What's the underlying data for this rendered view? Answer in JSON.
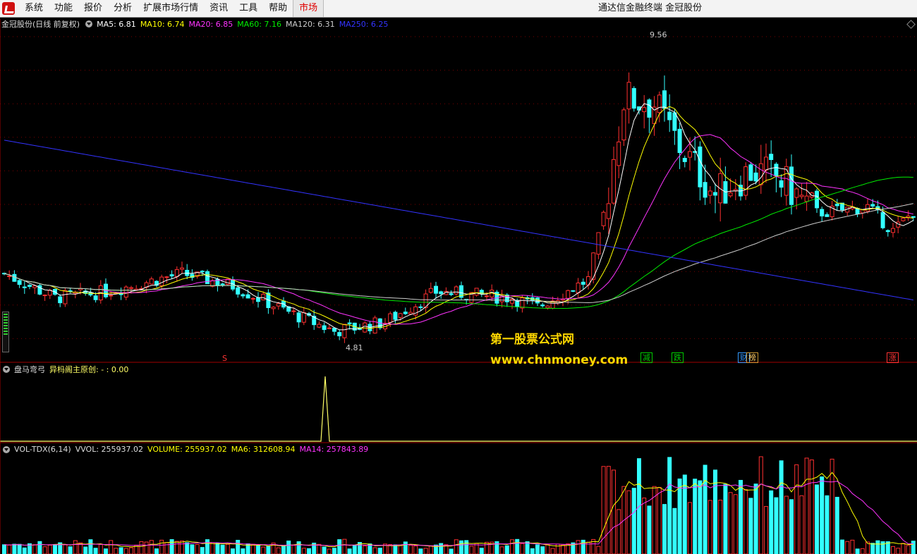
{
  "menu": {
    "items": [
      "系统",
      "功能",
      "报价",
      "分析",
      "扩展市场行情",
      "资讯",
      "工具",
      "帮助"
    ],
    "active_item": "市场",
    "window_title": "通达信金融终端  金冠股份"
  },
  "price_panel": {
    "stock_label": "金冠股份(日线 前复权)",
    "ma": [
      {
        "label": "MA5: 6.81",
        "color": "#ffffff"
      },
      {
        "label": "MA10: 6.74",
        "color": "#ffff00"
      },
      {
        "label": "MA20: 6.85",
        "color": "#ff33ff"
      },
      {
        "label": "MA60: 7.16",
        "color": "#00ee00"
      },
      {
        "label": "MA120: 6.31",
        "color": "#cccccc"
      },
      {
        "label": "MA250: 6.25",
        "color": "#3333ff"
      }
    ],
    "high_label": "9.56",
    "low_label": "4.81",
    "price_range": [
      4.6,
      9.9
    ]
  },
  "markers": {
    "s": "S",
    "tags": [
      {
        "text": "减",
        "color": "#00cc00",
        "border": "#00cc00"
      },
      {
        "text": "跌",
        "color": "#00cc00",
        "border": "#00cc00"
      },
      {
        "text": "财",
        "color": "#3399ff",
        "border": "#3399ff"
      },
      {
        "text": "榜",
        "color": "#ffcc66",
        "border": "#cc9933"
      },
      {
        "text": "涨",
        "color": "#ff3333",
        "border": "#ff3333"
      }
    ]
  },
  "watermark": {
    "line1": "第一股票公式网",
    "line2": "www.chnmoney.com"
  },
  "indicator_panel": {
    "name": "盘马弯弓",
    "line_label": "异杩阁主原创: - : 0.00",
    "spike_index": 100
  },
  "volume_panel": {
    "title": "VOL-TDX(6,14)",
    "vvol": "VVOL: 255937.02",
    "volume": "VOLUME: 255937.02",
    "ma6": "MA6: 312608.94",
    "ma14": "MA14: 257843.89",
    "ma6_color": "#ffff00",
    "ma14_color": "#ff33ff"
  },
  "colors": {
    "up": "#ff3030",
    "down": "#33ffff",
    "menu_active": "#e00000",
    "ma250": "#3333ff",
    "ma60": "#00ee00",
    "ma120": "#cccccc",
    "ma20": "#ff33ff"
  }
}
